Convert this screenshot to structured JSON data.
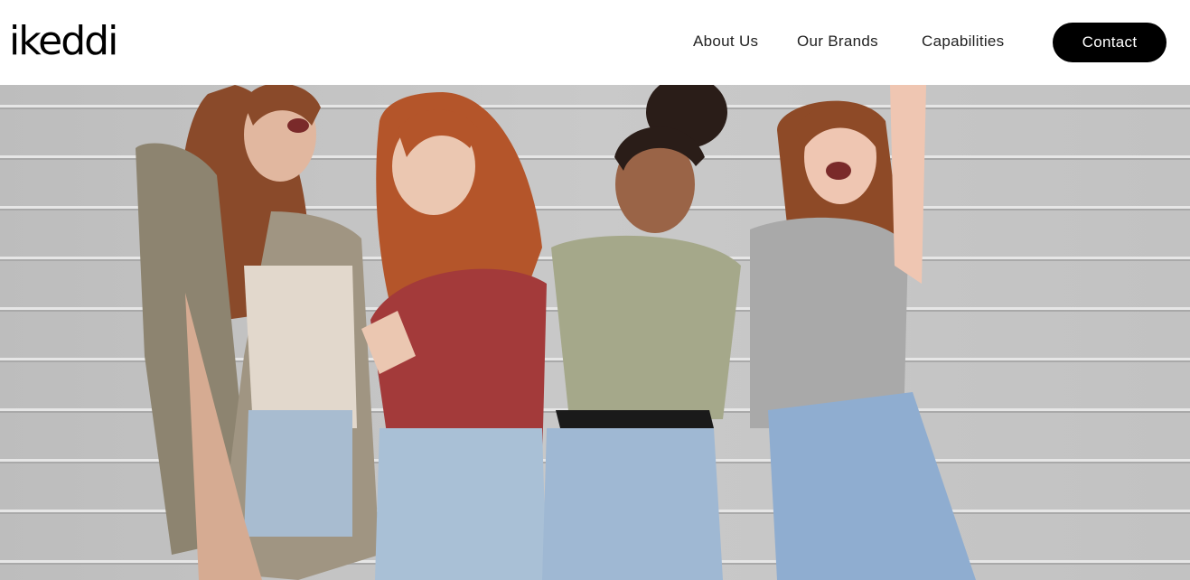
{
  "header": {
    "logo_text": "ikeddi",
    "nav": {
      "about": "About Us",
      "brands": "Our Brands",
      "capabilities": "Capabilities"
    },
    "contact_label": "Contact"
  },
  "hero": {
    "image_subject": "hero-photo"
  }
}
